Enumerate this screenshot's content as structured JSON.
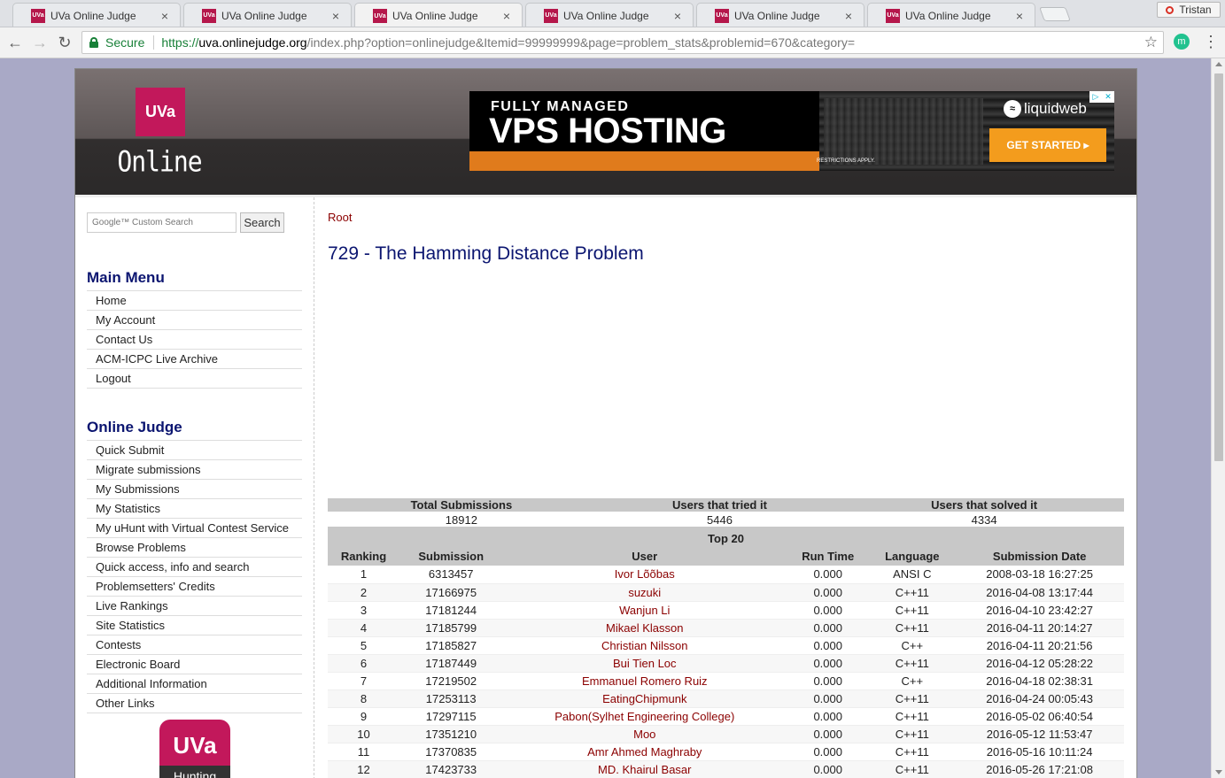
{
  "browser": {
    "tabs": [
      {
        "title": "UVa Online Judge",
        "active": false
      },
      {
        "title": "UVa Online Judge",
        "active": false
      },
      {
        "title": "UVa Online Judge",
        "active": true
      },
      {
        "title": "UVa Online Judge",
        "active": false
      },
      {
        "title": "UVa Online Judge",
        "active": false
      },
      {
        "title": "UVa Online Judge",
        "active": false
      }
    ],
    "favicon_text": "UVa",
    "profile_name": "Tristan",
    "secure_label": "Secure",
    "url_scheme": "https://",
    "url_host": "uva.onlinejudge.org",
    "url_rest": "/index.php?option=onlinejudge&Itemid=99999999&page=problem_stats&problemid=670&category=",
    "extension_letter": "m"
  },
  "header": {
    "logo_box": "UVa",
    "logo_text": "Online Judge",
    "ad": {
      "line1": "FULLY MANAGED",
      "line2": "VPS HOSTING",
      "restrictions": "RESTRICTIONS APPLY.",
      "brand": "liquidweb",
      "cta": "GET STARTED ▸"
    }
  },
  "sidebar": {
    "search_placeholder": "Google™ Custom Search",
    "search_button": "Search",
    "main_menu_heading": "Main Menu",
    "main_menu": [
      "Home",
      "My Account",
      "Contact Us",
      "ACM-ICPC Live Archive",
      "Logout"
    ],
    "online_judge_heading": "Online Judge",
    "online_judge_menu": [
      "Quick Submit",
      "Migrate submissions",
      "My Submissions",
      "My Statistics",
      "My uHunt with Virtual Contest Service",
      "Browse Problems",
      "Quick access, info and search",
      "Problemsetters' Credits",
      "Live Rankings",
      "Site Statistics",
      "Contests",
      "Electronic Board",
      "Additional Information",
      "Other Links"
    ],
    "hunting_logo_top": "UVa",
    "hunting_logo_bottom": "Hunting"
  },
  "content": {
    "breadcrumb": "Root",
    "problem_title": "729 - The Hamming Distance Problem",
    "stats": {
      "headers": [
        "Total Submissions",
        "Users that tried it",
        "Users that solved it"
      ],
      "values": [
        "18912",
        "5446",
        "4334"
      ]
    },
    "top20": {
      "caption": "Top 20",
      "headers": [
        "Ranking",
        "Submission",
        "User",
        "Run Time",
        "Language",
        "Submission Date"
      ],
      "rows": [
        [
          "1",
          "6313457",
          "Ivor Lõõbas",
          "0.000",
          "ANSI C",
          "2008-03-18 16:27:25"
        ],
        [
          "2",
          "17166975",
          "suzuki",
          "0.000",
          "C++11",
          "2016-04-08 13:17:44"
        ],
        [
          "3",
          "17181244",
          "Wanjun Li",
          "0.000",
          "C++11",
          "2016-04-10 23:42:27"
        ],
        [
          "4",
          "17185799",
          "Mikael Klasson",
          "0.000",
          "C++11",
          "2016-04-11 20:14:27"
        ],
        [
          "5",
          "17185827",
          "Christian Nilsson",
          "0.000",
          "C++",
          "2016-04-11 20:21:56"
        ],
        [
          "6",
          "17187449",
          "Bui Tien Loc",
          "0.000",
          "C++11",
          "2016-04-12 05:28:22"
        ],
        [
          "7",
          "17219502",
          "Emmanuel Romero Ruiz",
          "0.000",
          "C++",
          "2016-04-18 02:38:31"
        ],
        [
          "8",
          "17253113",
          "EatingChipmunk",
          "0.000",
          "C++11",
          "2016-04-24 00:05:43"
        ],
        [
          "9",
          "17297115",
          "Pabon(Sylhet Engineering College)",
          "0.000",
          "C++11",
          "2016-05-02 06:40:54"
        ],
        [
          "10",
          "17351210",
          "Moo",
          "0.000",
          "C++11",
          "2016-05-12 11:53:47"
        ],
        [
          "11",
          "17370835",
          "Amr Ahmed Maghraby",
          "0.000",
          "C++11",
          "2016-05-16 10:11:24"
        ],
        [
          "12",
          "17423733",
          "MD. Khairul Basar",
          "0.000",
          "C++11",
          "2016-05-26 17:21:08"
        ]
      ]
    }
  }
}
